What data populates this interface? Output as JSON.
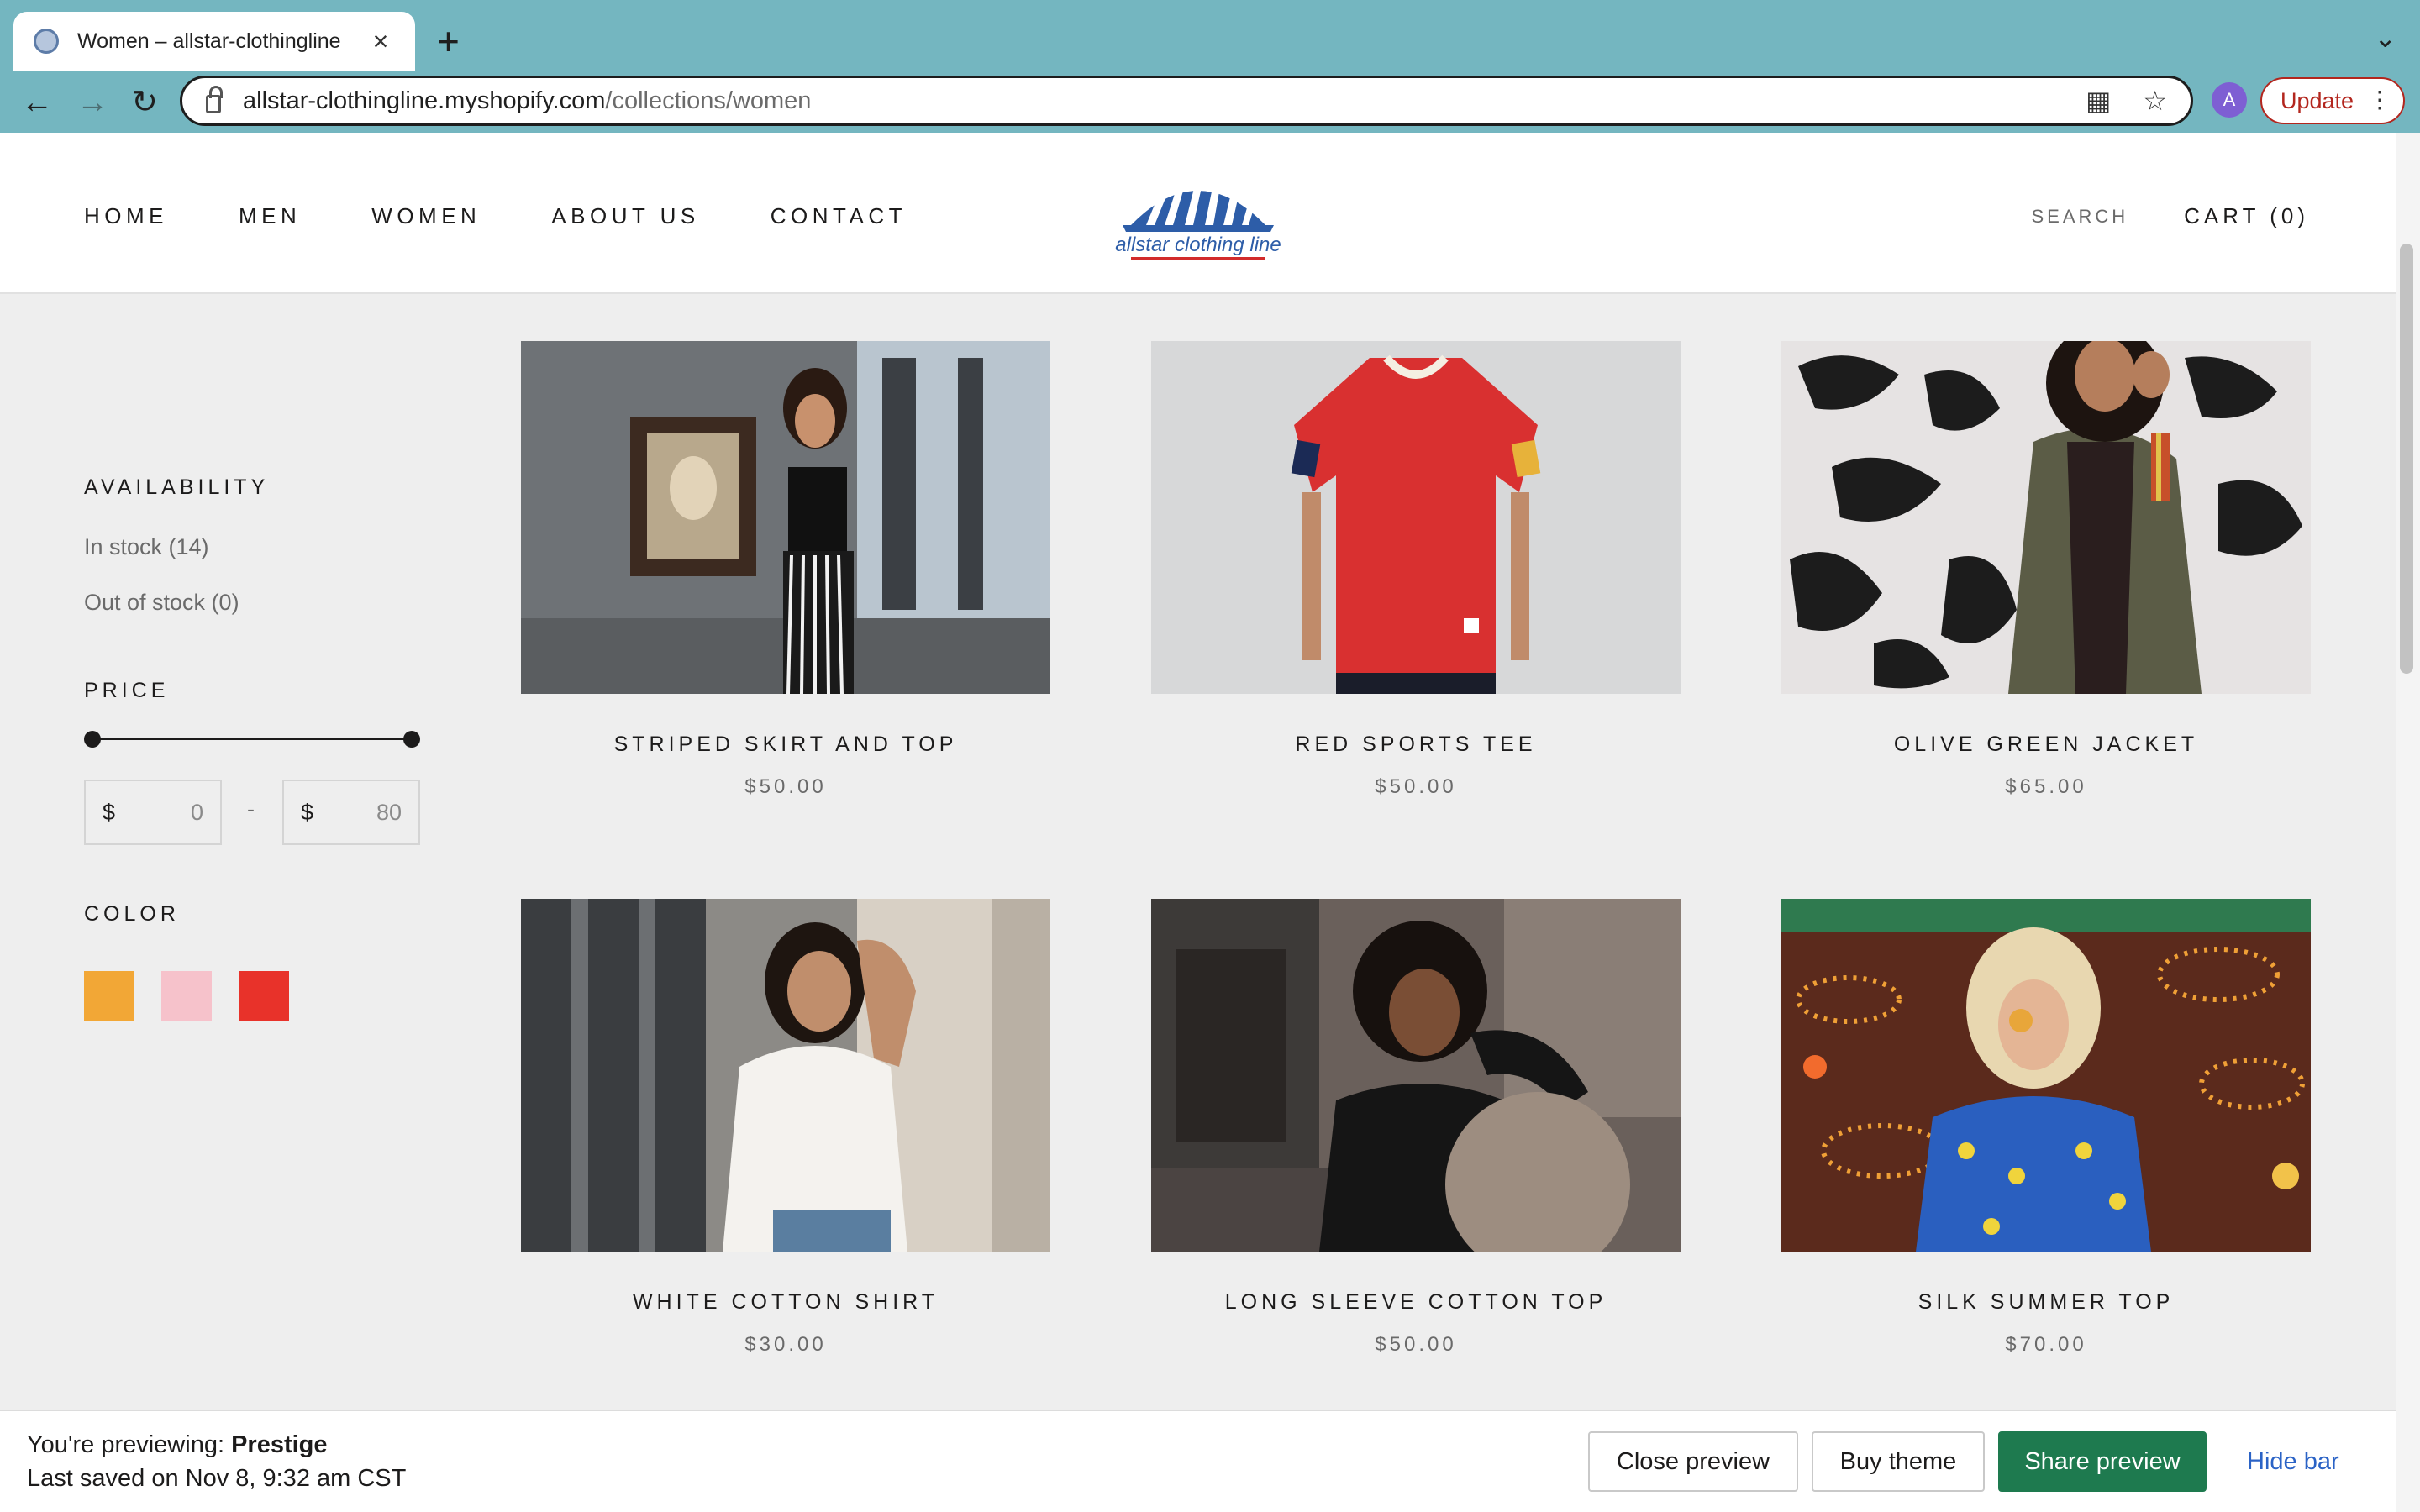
{
  "browser": {
    "tab_title": "Women – allstar-clothingline",
    "url_host": "allstar-clothingline.myshopify.com",
    "url_path": "/collections/women",
    "avatar_letter": "A",
    "update_label": "Update"
  },
  "store": {
    "nav": [
      "HOME",
      "MEN",
      "WOMEN",
      "ABOUT US",
      "CONTACT"
    ],
    "logo_text": "allstar clothing line",
    "search_label": "SEARCH",
    "cart_label": "CART (0)"
  },
  "filters": {
    "availability_title": "AVAILABILITY",
    "in_stock": "In stock (14)",
    "out_of_stock": "Out of stock (0)",
    "price_title": "PRICE",
    "currency": "$",
    "min": "0",
    "max": "80",
    "separator": "-",
    "color_title": "COLOR",
    "colors": [
      "#f2a736",
      "#f6c2cb",
      "#e8322a"
    ]
  },
  "products": [
    {
      "name": "STRIPED SKIRT AND TOP",
      "price": "$50.00"
    },
    {
      "name": "RED SPORTS TEE",
      "price": "$50.00"
    },
    {
      "name": "OLIVE GREEN JACKET",
      "price": "$65.00"
    },
    {
      "name": "WHITE COTTON SHIRT",
      "price": "$30.00"
    },
    {
      "name": "LONG SLEEVE COTTON TOP",
      "price": "$50.00"
    },
    {
      "name": "SILK SUMMER TOP",
      "price": "$70.00"
    }
  ],
  "preview_bar": {
    "previewing_prefix": "You're previewing: ",
    "theme_name": "Prestige",
    "last_saved": "Last saved on Nov 8, 9:32 am CST",
    "close_preview": "Close preview",
    "buy_theme": "Buy theme",
    "share_preview": "Share preview",
    "hide_bar": "Hide bar"
  }
}
